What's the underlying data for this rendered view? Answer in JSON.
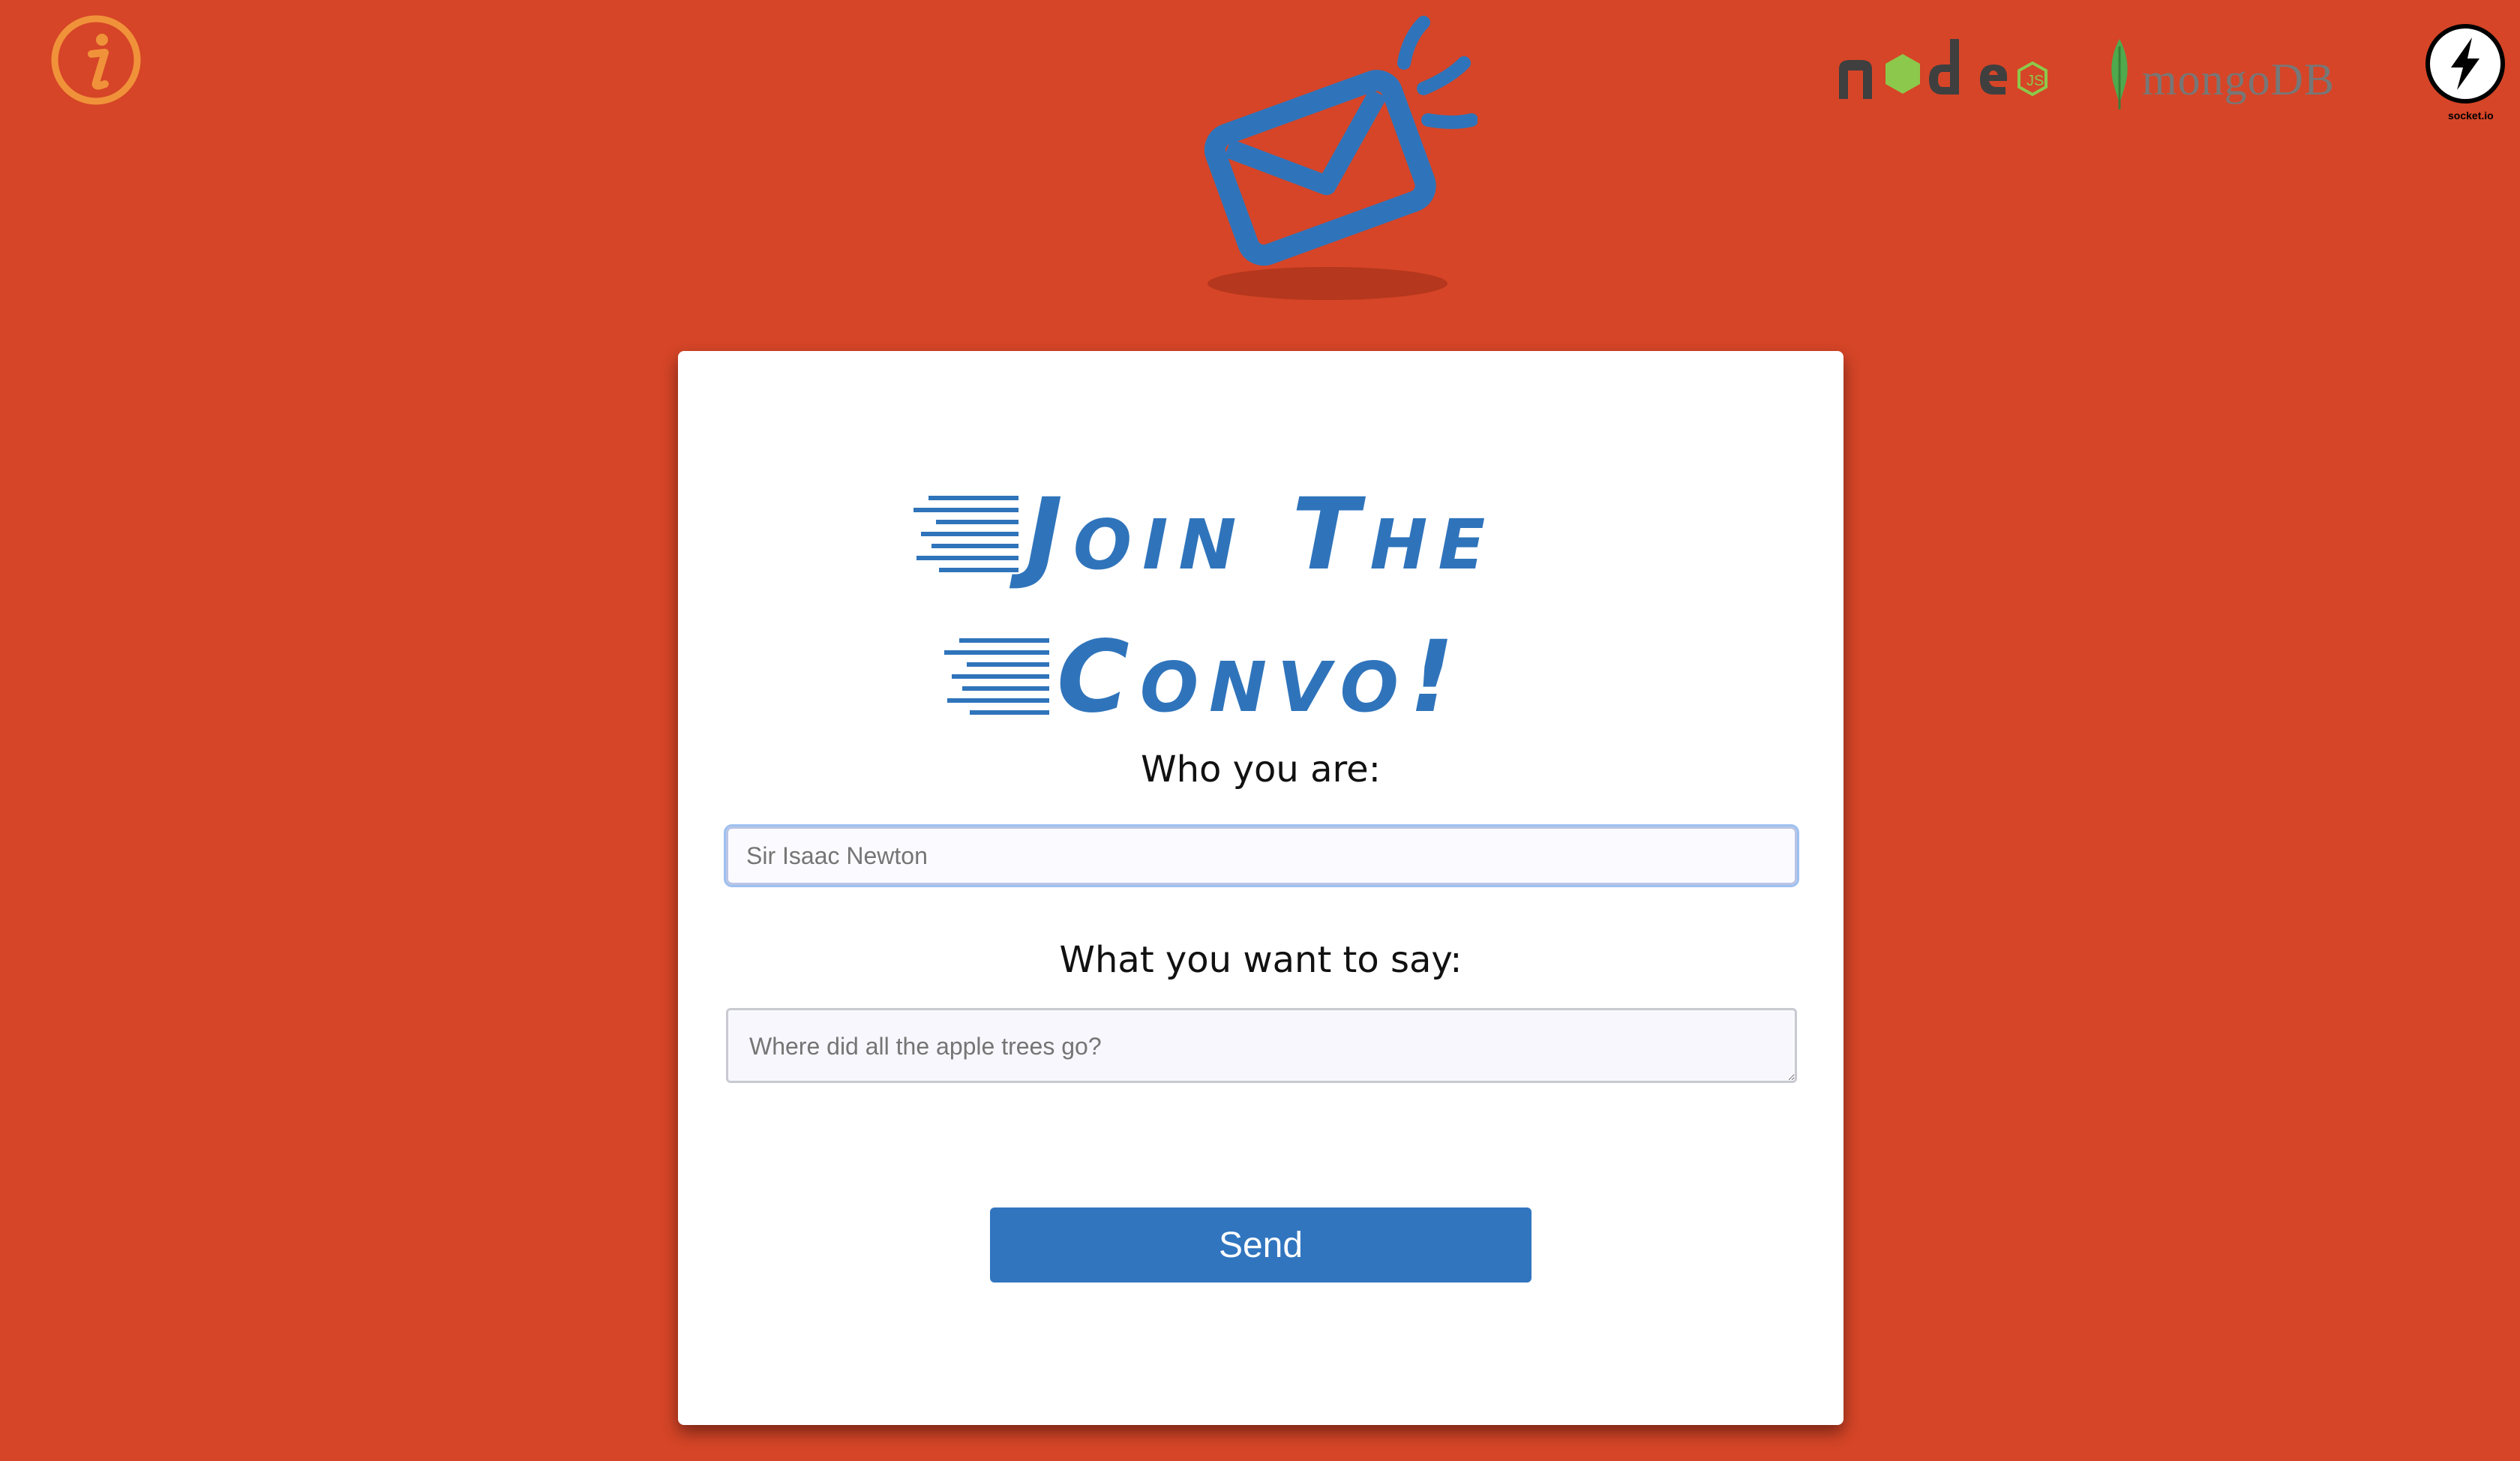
{
  "header": {
    "info_icon": "info-icon",
    "node_logo": "nodejs-logo",
    "mongo_logo_text": "mongoDB",
    "socket_logo_text": "socket.io",
    "brand_icon": "envelope-icon"
  },
  "card": {
    "title_line1": "Join The",
    "title_line2": "Convo!",
    "name_label": "Who you are:",
    "name_placeholder": "Sir Isaac Newton",
    "message_label": "What you want to say:",
    "message_placeholder": "Where did all the apple trees go?",
    "send_label": "Send"
  },
  "colors": {
    "background": "#d64527",
    "accent": "#2f74bb",
    "info_orange": "#f0923a",
    "node_green": "#8cc84b"
  }
}
